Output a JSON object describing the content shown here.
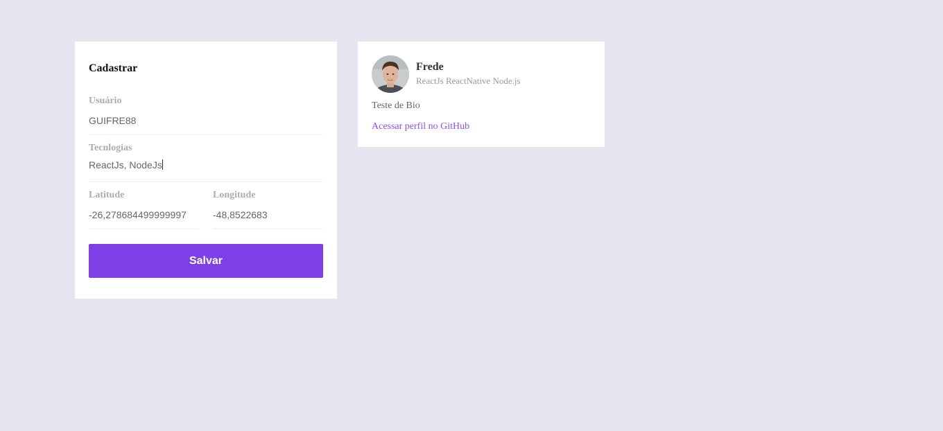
{
  "form": {
    "title": "Cadastrar",
    "username": {
      "label": "Usuário",
      "value": "GUIFRE88"
    },
    "techs": {
      "label": "Tecnlogias",
      "value": "ReactJs, NodeJs"
    },
    "latitude": {
      "label": "Latitude",
      "value": "-26,278684499999997"
    },
    "longitude": {
      "label": "Longitude",
      "value": "-48,8522683"
    },
    "submit_label": "Salvar"
  },
  "colors": {
    "background": "#e5e5ef",
    "accent": "#7d40e7",
    "link": "#8e4dff"
  },
  "dev": {
    "name": "Frede",
    "techs": "ReactJs ReactNative Node.js",
    "bio": "Teste de Bio",
    "link_label": "Acessar perfil no GitHub",
    "avatar_icon": "user-photo"
  }
}
